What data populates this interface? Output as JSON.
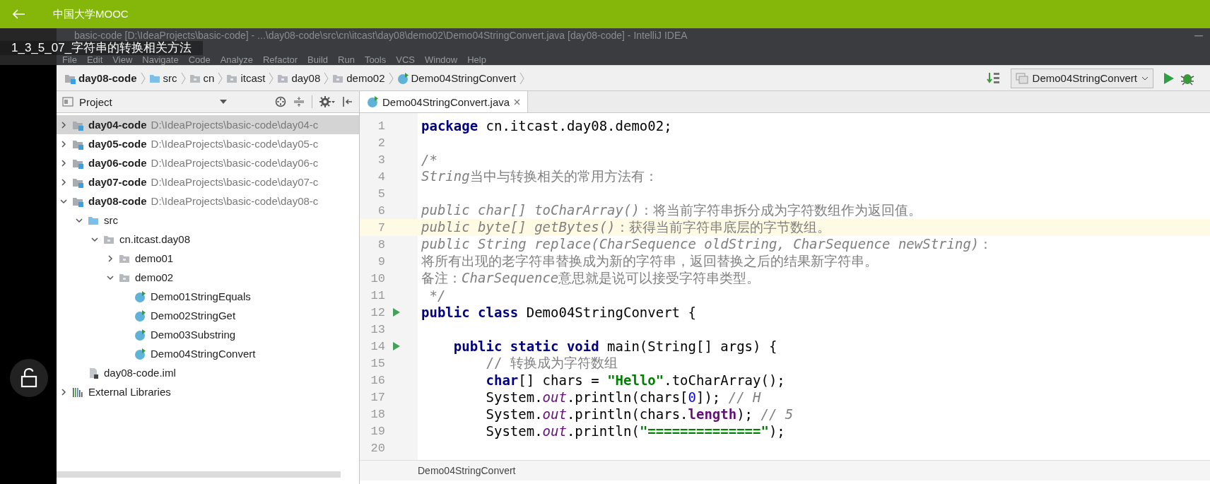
{
  "app_bar": {
    "title": "中国大学MOOC"
  },
  "video_title": "1_3_5_07_字符串的转换相关方法",
  "ide": {
    "window_title": "basic-code [D:\\IdeaProjects\\basic-code] - ...\\day08-code\\src\\cn\\itcast\\day08\\demo02\\Demo04StringConvert.java [day08-code] - IntelliJ IDEA",
    "menu": [
      "File",
      "Edit",
      "View",
      "Navigate",
      "Code",
      "Analyze",
      "Refactor",
      "Build",
      "Run",
      "Tools",
      "VCS",
      "Window",
      "Help"
    ],
    "breadcrumbs": [
      {
        "label": "day08-code",
        "kind": "module"
      },
      {
        "label": "src",
        "kind": "source"
      },
      {
        "label": "cn",
        "kind": "package"
      },
      {
        "label": "itcast",
        "kind": "package"
      },
      {
        "label": "day08",
        "kind": "package"
      },
      {
        "label": "demo02",
        "kind": "package"
      },
      {
        "label": "Demo04StringConvert",
        "kind": "class"
      }
    ],
    "run_config": "Demo04StringConvert",
    "project_panel": {
      "title": "Project",
      "tree": [
        {
          "name": "day04-code",
          "path": "D:\\IdeaProjects\\basic-code\\day04-c",
          "kind": "module",
          "expanded": false,
          "selected": true
        },
        {
          "name": "day05-code",
          "path": "D:\\IdeaProjects\\basic-code\\day05-c",
          "kind": "module",
          "expanded": false,
          "selected": false
        },
        {
          "name": "day06-code",
          "path": "D:\\IdeaProjects\\basic-code\\day06-c",
          "kind": "module",
          "expanded": false,
          "selected": false
        },
        {
          "name": "day07-code",
          "path": "D:\\IdeaProjects\\basic-code\\day07-c",
          "kind": "module",
          "expanded": false,
          "selected": false
        },
        {
          "name": "day08-code",
          "path": "D:\\IdeaProjects\\basic-code\\day08-c",
          "kind": "module",
          "expanded": true,
          "selected": false,
          "children": [
            {
              "name": "src",
              "kind": "source",
              "expanded": true,
              "selected": false,
              "children": [
                {
                  "name": "cn.itcast.day08",
                  "kind": "package",
                  "expanded": true,
                  "selected": false,
                  "children": [
                    {
                      "name": "demo01",
                      "kind": "package",
                      "expanded": false,
                      "selected": false
                    },
                    {
                      "name": "demo02",
                      "kind": "package",
                      "expanded": true,
                      "selected": false,
                      "children": [
                        {
                          "name": "Demo01StringEquals",
                          "kind": "class",
                          "selected": false
                        },
                        {
                          "name": "Demo02StringGet",
                          "kind": "class",
                          "selected": false
                        },
                        {
                          "name": "Demo03Substring",
                          "kind": "class",
                          "selected": false
                        },
                        {
                          "name": "Demo04StringConvert",
                          "kind": "class",
                          "selected": false
                        }
                      ]
                    }
                  ]
                }
              ]
            },
            {
              "name": "day08-code.iml",
              "kind": "file",
              "selected": false
            }
          ]
        },
        {
          "name": "External Libraries",
          "kind": "library",
          "expanded": false,
          "selected": false
        }
      ]
    },
    "editor": {
      "tabs": [
        {
          "label": "Demo04StringConvert.java",
          "selected": true
        }
      ],
      "lines": [
        {
          "number": "1",
          "run": false,
          "current": false,
          "segments": [
            {
              "text": "package ",
              "kind": "keyword"
            },
            {
              "text": "cn.itcast.day08.demo02;",
              "kind": "text"
            }
          ]
        },
        {
          "number": "2",
          "run": false,
          "current": false
        },
        {
          "number": "3",
          "run": false,
          "current": false,
          "segments": [
            {
              "text": "/*",
              "kind": "comment"
            }
          ]
        },
        {
          "number": "4",
          "run": false,
          "current": false,
          "segments": [
            {
              "text": "String",
              "kind": "comment"
            },
            {
              "text": "当中与转换相关的常用方法有：",
              "kind": "comment-plain"
            }
          ]
        },
        {
          "number": "5",
          "run": false,
          "current": false
        },
        {
          "number": "6",
          "run": false,
          "current": false,
          "segments": [
            {
              "text": "public char[] toCharArray()",
              "kind": "comment"
            },
            {
              "text": "：将当前字符串拆分成为字符数组作为返回值。",
              "kind": "comment-plain"
            }
          ]
        },
        {
          "number": "7",
          "run": false,
          "current": true,
          "segments": [
            {
              "text": "public byte[] getBytes()",
              "kind": "comment"
            },
            {
              "text": "：获得当前字符串底层的字节数组。",
              "kind": "comment-plain"
            }
          ]
        },
        {
          "number": "8",
          "run": false,
          "current": false,
          "segments": [
            {
              "text": "public String replace(CharSequence oldString, CharSequence newString)",
              "kind": "comment"
            },
            {
              "text": "：",
              "kind": "comment-plain"
            }
          ]
        },
        {
          "number": "9",
          "run": false,
          "current": false,
          "segments": [
            {
              "text": "将所有出现的老字符串替换成为新的字符串，返回替换之后的结果新字符串。",
              "kind": "comment-plain"
            }
          ]
        },
        {
          "number": "10",
          "run": false,
          "current": false,
          "segments": [
            {
              "text": "备注：",
              "kind": "comment-plain"
            },
            {
              "text": "CharSequence",
              "kind": "comment"
            },
            {
              "text": "意思就是说可以接受字符串类型。",
              "kind": "comment-plain"
            }
          ]
        },
        {
          "number": "11",
          "run": false,
          "current": false,
          "segments": [
            {
              "text": " */",
              "kind": "comment"
            }
          ]
        },
        {
          "number": "12",
          "run": true,
          "current": false,
          "segments": [
            {
              "text": "public class ",
              "kind": "keyword"
            },
            {
              "text": "Demo04StringConvert {",
              "kind": "text"
            }
          ]
        },
        {
          "number": "13",
          "run": false,
          "current": false
        },
        {
          "number": "14",
          "run": true,
          "current": false,
          "segments": [
            {
              "text": "    public static void ",
              "kind": "keyword"
            },
            {
              "text": "main(String[] args) {",
              "kind": "text"
            }
          ]
        },
        {
          "number": "15",
          "run": false,
          "current": false,
          "segments": [
            {
              "text": "        // 转换成为字符数组",
              "kind": "comment-plain"
            }
          ]
        },
        {
          "number": "16",
          "run": false,
          "current": false,
          "segments": [
            {
              "text": "        char",
              "kind": "keyword"
            },
            {
              "text": "[] chars = ",
              "kind": "text"
            },
            {
              "text": "\"Hello\"",
              "kind": "string"
            },
            {
              "text": ".toCharArray();",
              "kind": "text"
            }
          ]
        },
        {
          "number": "17",
          "run": false,
          "current": false,
          "segments": [
            {
              "text": "        System.",
              "kind": "text"
            },
            {
              "text": "out",
              "kind": "field"
            },
            {
              "text": ".println(chars[",
              "kind": "text"
            },
            {
              "text": "0",
              "kind": "number"
            },
            {
              "text": "]); ",
              "kind": "text"
            },
            {
              "text": "// H",
              "kind": "comment"
            }
          ]
        },
        {
          "number": "18",
          "run": false,
          "current": false,
          "segments": [
            {
              "text": "        System.",
              "kind": "text"
            },
            {
              "text": "out",
              "kind": "field"
            },
            {
              "text": ".println(chars.",
              "kind": "text"
            },
            {
              "text": "length",
              "kind": "member"
            },
            {
              "text": "); ",
              "kind": "text"
            },
            {
              "text": "// 5",
              "kind": "comment"
            }
          ]
        },
        {
          "number": "19",
          "run": false,
          "current": false,
          "segments": [
            {
              "text": "        System.",
              "kind": "text"
            },
            {
              "text": "out",
              "kind": "field"
            },
            {
              "text": ".println(",
              "kind": "text"
            },
            {
              "text": "\"==============\"",
              "kind": "string"
            },
            {
              "text": ");",
              "kind": "text"
            }
          ]
        },
        {
          "number": "20",
          "run": false,
          "current": false
        }
      ],
      "breadcrumb": "Demo04StringConvert"
    }
  }
}
